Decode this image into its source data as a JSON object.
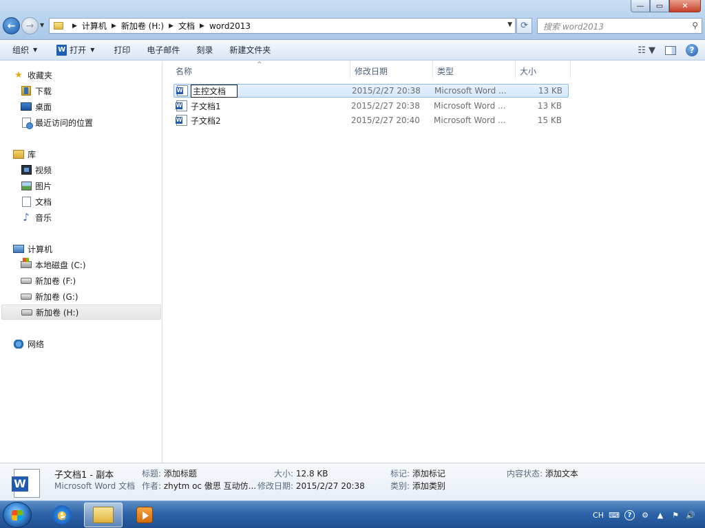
{
  "window": {
    "caption": {
      "minimize": "—",
      "maximize": "▭",
      "close": "✕"
    }
  },
  "address_bar": {
    "breadcrumbs": [
      "计算机",
      "新加卷 (H:)",
      "文档",
      "word2013"
    ],
    "search_placeholder": "搜索 word2013"
  },
  "toolbar": {
    "organize": "组织",
    "open": "打开",
    "print": "打印",
    "email": "电子邮件",
    "burn": "刻录",
    "new_folder": "新建文件夹"
  },
  "nav": {
    "favorites": {
      "label": "收藏夹",
      "items": [
        "下载",
        "桌面",
        "最近访问的位置"
      ]
    },
    "libraries": {
      "label": "库",
      "items": [
        "视频",
        "图片",
        "文档",
        "音乐"
      ]
    },
    "computer": {
      "label": "计算机",
      "items": [
        "本地磁盘 (C:)",
        "新加卷 (F:)",
        "新加卷 (G:)",
        "新加卷 (H:)"
      ],
      "selected": "新加卷 (H:)"
    },
    "network": {
      "label": "网络"
    }
  },
  "files": {
    "columns": [
      "名称",
      "修改日期",
      "类型",
      "大小"
    ],
    "rows": [
      {
        "name": "主控文档",
        "date": "2015/2/27 20:38",
        "type": "Microsoft Word ...",
        "size": "13 KB",
        "state": "renaming"
      },
      {
        "name": "子文档1",
        "date": "2015/2/27 20:38",
        "type": "Microsoft Word ...",
        "size": "13 KB"
      },
      {
        "name": "子文档2",
        "date": "2015/2/27 20:40",
        "type": "Microsoft Word ...",
        "size": "15 KB"
      }
    ]
  },
  "details": {
    "name": "子文档1 - 副本",
    "file_type": "Microsoft Word 文档",
    "title_label": "标题:",
    "title_value": "添加标题",
    "author_label": "作者:",
    "author_value": "zhytm oc 傲思   互动仿...",
    "size_label": "大小:",
    "size_value": "12.8 KB",
    "modified_label": "修改日期:",
    "modified_value": "2015/2/27 20:38",
    "tags_label": "标记:",
    "tags_value": "添加标记",
    "category_label": "类别:",
    "category_value": "添加类别",
    "content_status_label": "内容状态:",
    "content_status_value": "添加文本"
  },
  "taskbar": {
    "apps": [
      "internet-explorer",
      "windows-explorer",
      "media-player"
    ],
    "tray": {
      "language": "CH"
    }
  },
  "colors": {
    "selection_bg": "#dcebfc",
    "selection_border": "#8fb9e8",
    "taskbar": "#2d64a9"
  }
}
